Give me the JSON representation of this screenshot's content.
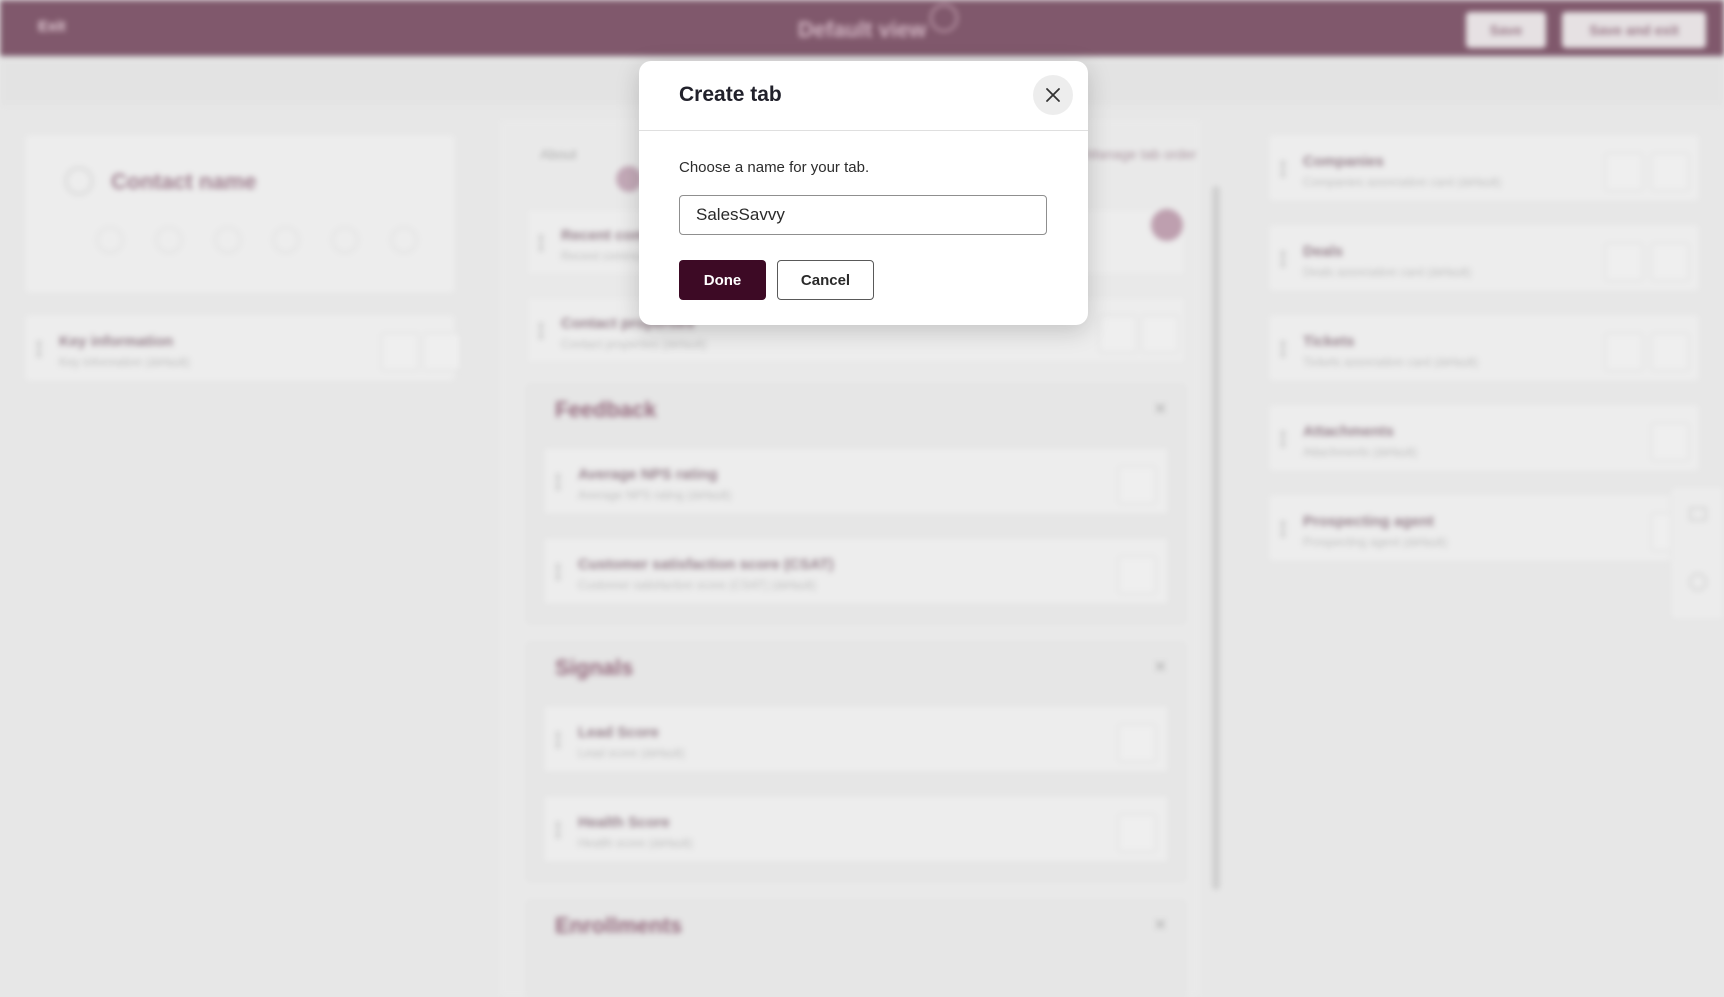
{
  "topbar": {
    "exit_label": "Exit",
    "title": "Default view",
    "save_label": "Save",
    "save_exit_label": "Save and exit"
  },
  "left": {
    "contact_name": "Contact name",
    "key_info": {
      "title": "Key information",
      "subtitle": "Key information (default)"
    }
  },
  "middle": {
    "tab_label": "About",
    "manage_tabs": "Manage tab order",
    "cards": [
      {
        "title": "Recent communications",
        "subtitle": "Recent communications (default)"
      },
      {
        "title": "Contact properties",
        "subtitle": "Contact properties (default)"
      }
    ],
    "sections": [
      {
        "title": "Feedback",
        "cards": [
          {
            "title": "Average NPS rating",
            "subtitle": "Average NPS rating (default)"
          },
          {
            "title": "Customer satisfaction score (CSAT)",
            "subtitle": "Customer satisfaction score (CSAT) (default)"
          }
        ]
      },
      {
        "title": "Signals",
        "cards": [
          {
            "title": "Lead Score",
            "subtitle": "Lead score (default)"
          },
          {
            "title": "Health Score",
            "subtitle": "Health score (default)"
          }
        ]
      },
      {
        "title": "Enrollments"
      }
    ]
  },
  "right": {
    "cards": [
      {
        "title": "Companies",
        "subtitle": "Companies association card (default)"
      },
      {
        "title": "Deals",
        "subtitle": "Deals association card (default)"
      },
      {
        "title": "Tickets",
        "subtitle": "Tickets association card (default)"
      },
      {
        "title": "Attachments",
        "subtitle": "Attachments (default)"
      },
      {
        "title": "Prospecting agent",
        "subtitle": "Prospecting agent (default)"
      }
    ]
  },
  "modal": {
    "title": "Create tab",
    "label": "Choose a name for your tab.",
    "input_value": "SalesSavvy",
    "done_label": "Done",
    "cancel_label": "Cancel",
    "close_icon": "close-icon"
  }
}
